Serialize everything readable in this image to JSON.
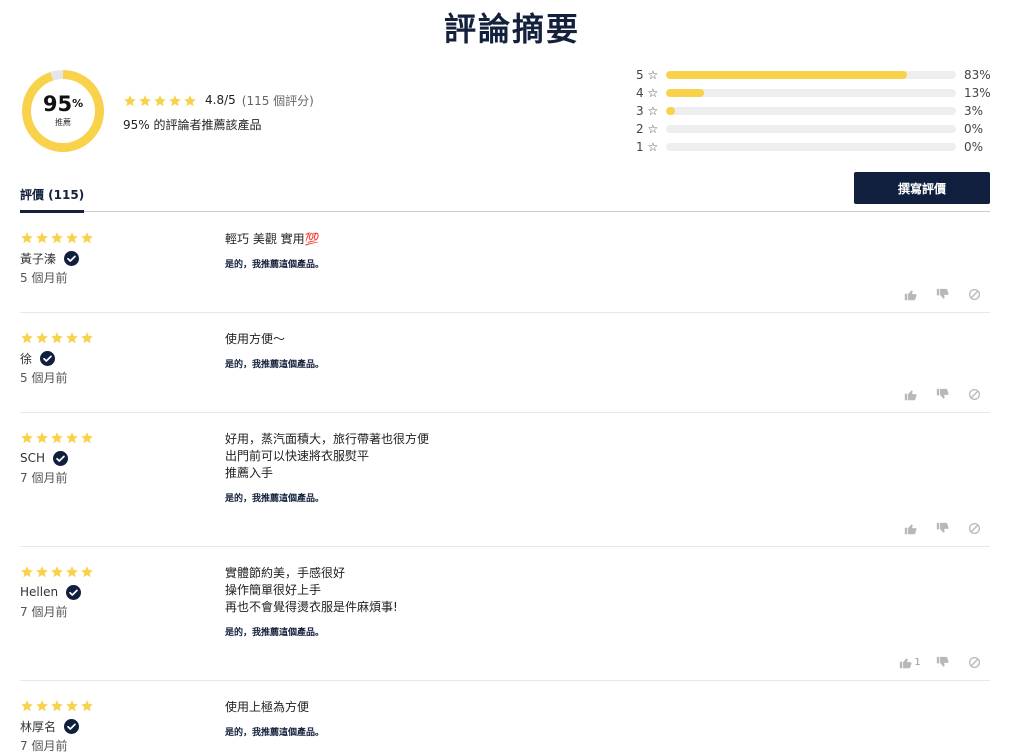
{
  "summary": {
    "title": "評論摘要",
    "recommend_pct": 95,
    "recommend_pct_text": "95",
    "recommend_pct_symbol": "%",
    "recommend_label": "推薦",
    "avg_score_text": "4.8/5",
    "review_count_text": "(115 個評分)",
    "recommend_sentence": "95% 的評論者推薦該產品",
    "star_color": "#f8d24a",
    "distribution": [
      {
        "label": "5 ☆",
        "pct": 83,
        "pct_text": "83%"
      },
      {
        "label": "4 ☆",
        "pct": 13,
        "pct_text": "13%"
      },
      {
        "label": "3 ☆",
        "pct": 3,
        "pct_text": "3%"
      },
      {
        "label": "2 ☆",
        "pct": 0,
        "pct_text": "0%"
      },
      {
        "label": "1 ☆",
        "pct": 0,
        "pct_text": "0%"
      }
    ]
  },
  "tabs": {
    "reviews_label": "評價 (115)"
  },
  "write_review_label": "撰寫評價",
  "accent_color": "#0f1f3d",
  "reviews": [
    {
      "name": "黃子溱",
      "time": "5 個月前",
      "rating": 5,
      "lines": [
        "輕巧 美觀 實用💯"
      ],
      "recommend": "是的，我推薦這個產品。",
      "helpful": ""
    },
    {
      "name": "徐",
      "time": "5 個月前",
      "rating": 5,
      "lines": [
        "使用方便～"
      ],
      "recommend": "是的，我推薦這個產品。",
      "helpful": ""
    },
    {
      "name": "SCH",
      "time": "7 個月前",
      "rating": 5,
      "lines": [
        "好用，蒸汽面積大，旅行帶著也很方便",
        "出門前可以快速將衣服熨平",
        "推薦入手"
      ],
      "recommend": "是的，我推薦這個產品。",
      "helpful": ""
    },
    {
      "name": "Hellen",
      "time": "7 個月前",
      "rating": 5,
      "lines": [
        "實體節約美，手感很好",
        "操作簡單很好上手",
        "再也不會覺得燙衣服是件麻煩事!"
      ],
      "recommend": "是的，我推薦這個產品。",
      "helpful": "1"
    },
    {
      "name": "林厚名",
      "time": "7 個月前",
      "rating": 5,
      "lines": [
        "使用上極為方便"
      ],
      "recommend": "是的，我推薦這個產品。",
      "helpful": ""
    }
  ]
}
